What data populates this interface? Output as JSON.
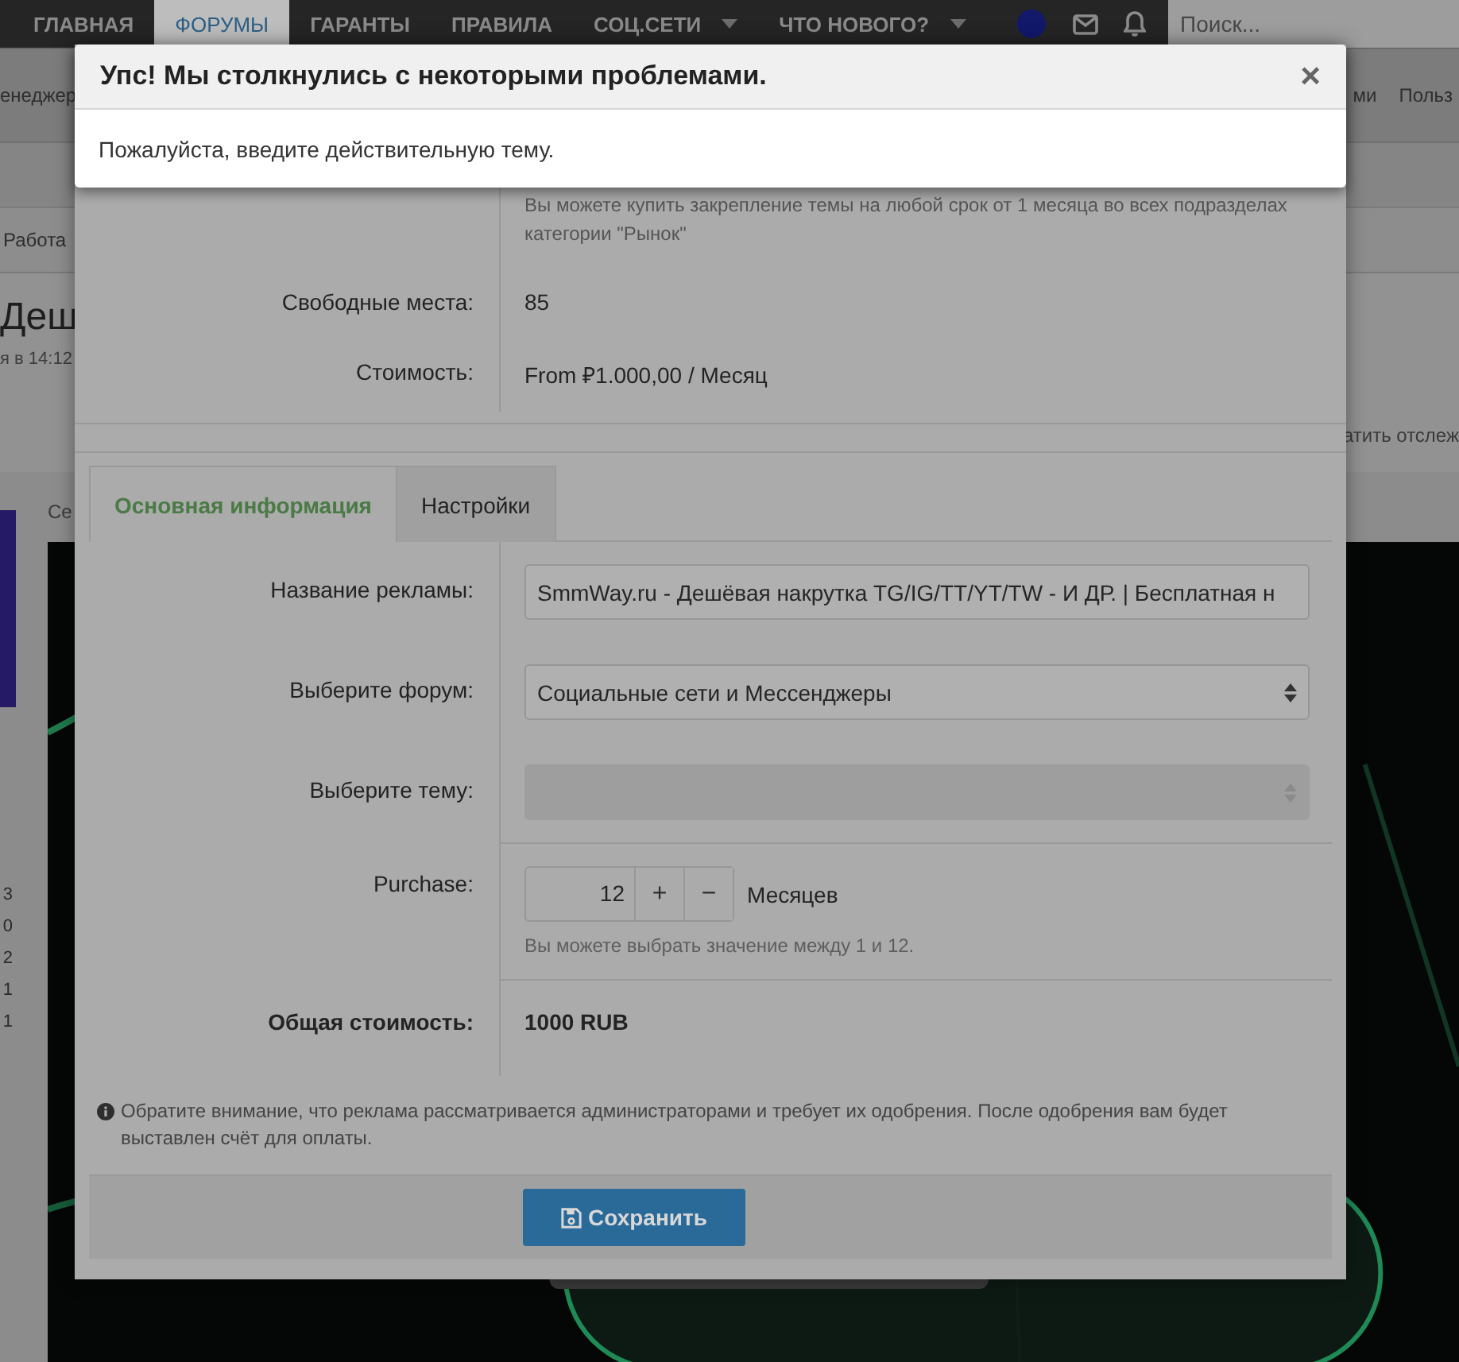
{
  "nav": {
    "items": [
      {
        "label": "ГЛАВНАЯ",
        "selected": false,
        "dropdown": false
      },
      {
        "label": "ФОРУМЫ",
        "selected": true,
        "dropdown": false
      },
      {
        "label": "ГАРАНТЫ",
        "selected": false,
        "dropdown": false
      },
      {
        "label": "ПРАВИЛА",
        "selected": false,
        "dropdown": false
      },
      {
        "label": "СОЦ.СЕТИ",
        "selected": false,
        "dropdown": true
      },
      {
        "label": "ЧТО НОВОГО?",
        "selected": false,
        "dropdown": true
      }
    ],
    "search": {
      "placeholder": "Поиск..."
    }
  },
  "background": {
    "subnav_left": "енеджер",
    "subnav_right": [
      "ми",
      "Польз"
    ],
    "breadcrumb": "Работа",
    "title": "Деш",
    "meta": "я в 14:12",
    "watch_link": "атить отслеж",
    "tab_fragment": "Се",
    "counts": [
      "3",
      "0",
      "2",
      "1",
      "1"
    ]
  },
  "modal": {
    "info_text": "Вы можете купить закрепление темы на любой срок от 1 месяца во всех подразделах категории \"Рынок\"",
    "rows": [
      {
        "label": "Свободные места:",
        "value": "85"
      },
      {
        "label": "Стоимость:",
        "value": "From ₽1.000,00 / Месяц"
      }
    ],
    "tabs": [
      {
        "label": "Основная информация",
        "selected": true
      },
      {
        "label": "Настройки",
        "selected": false
      }
    ],
    "fields": [
      {
        "kind": "text",
        "label": "Название рекламы:",
        "value": "SmmWay.ru - Дешёвая накрутка TG/IG/TT/YT/TW - И ДР. | Бесплатная н"
      },
      {
        "kind": "select",
        "label": "Выберите форум:",
        "value": "Социальные сети и Мессенджеры",
        "disabled": false
      },
      {
        "kind": "select",
        "label": "Выберите тему:",
        "disabled": true
      },
      {
        "kind": "quantity",
        "label": "Purchase:",
        "value": "12",
        "plus": "+",
        "minus": "−",
        "unit": "Месяцев",
        "hint": "Вы можете выбрать значение между 1 и 12."
      },
      {
        "kind": "total",
        "label": "Общая стоимость:",
        "value": "1000 RUB"
      }
    ],
    "note": "Обратите внимание, что реклама рассматривается администраторами и требует их одобрения. После одобрения вам будет выставлен счёт для оплаты.",
    "save_button": "Сохранить"
  },
  "alert": {
    "title": "Упс! Мы столкнулись с некоторыми проблемами.",
    "message": "Пожалуйста, введите действительную тему.",
    "close": "×"
  }
}
